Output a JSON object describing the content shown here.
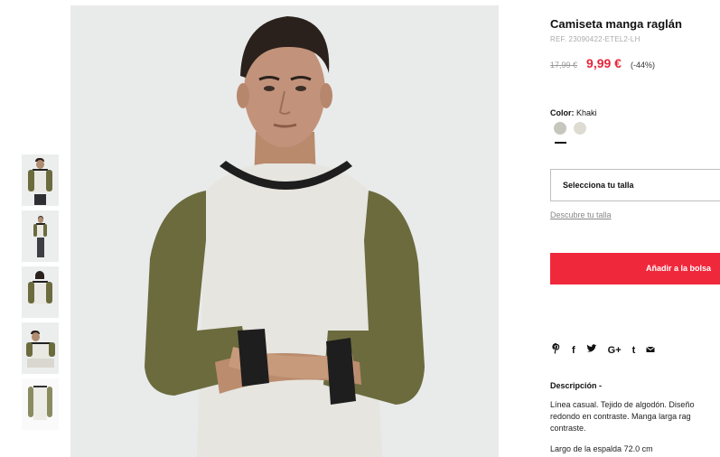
{
  "product": {
    "title": "Camiseta manga raglán",
    "ref": "REF. 23090422-ETEL2-LH",
    "old_price": "17,99 €",
    "new_price": "9,99 €",
    "discount": "(-44%)"
  },
  "color": {
    "label": "Color:",
    "value": "Khaki",
    "swatches": [
      {
        "name": "khaki",
        "hex": "#c7c6bd",
        "selected": true
      },
      {
        "name": "light",
        "hex": "#dedcd2",
        "selected": false
      }
    ]
  },
  "size": {
    "select_label": "Selecciona tu talla",
    "guide_link": "Descubre tu talla"
  },
  "actions": {
    "add_to_bag": "Añadir a la bolsa"
  },
  "share": {
    "icons": [
      "pinterest-icon",
      "facebook-icon",
      "twitter-icon",
      "google-plus-icon",
      "tumblr-icon",
      "email-icon"
    ],
    "glyphs": [
      "℗",
      "f",
      "𝕥",
      "G+",
      "t",
      "✉"
    ]
  },
  "description": {
    "title": "Descripción -",
    "lines": [
      "Línea casual. Tejido de algodón. Diseño",
      "redondo en contraste. Manga larga rag",
      "contraste."
    ],
    "length": "Largo de la espalda 72.0 cm"
  },
  "thumbnails": [
    "front",
    "full-body",
    "back",
    "seated",
    "flat"
  ],
  "colors": {
    "accent": "#f0283c",
    "sale_price": "#e8243a"
  }
}
